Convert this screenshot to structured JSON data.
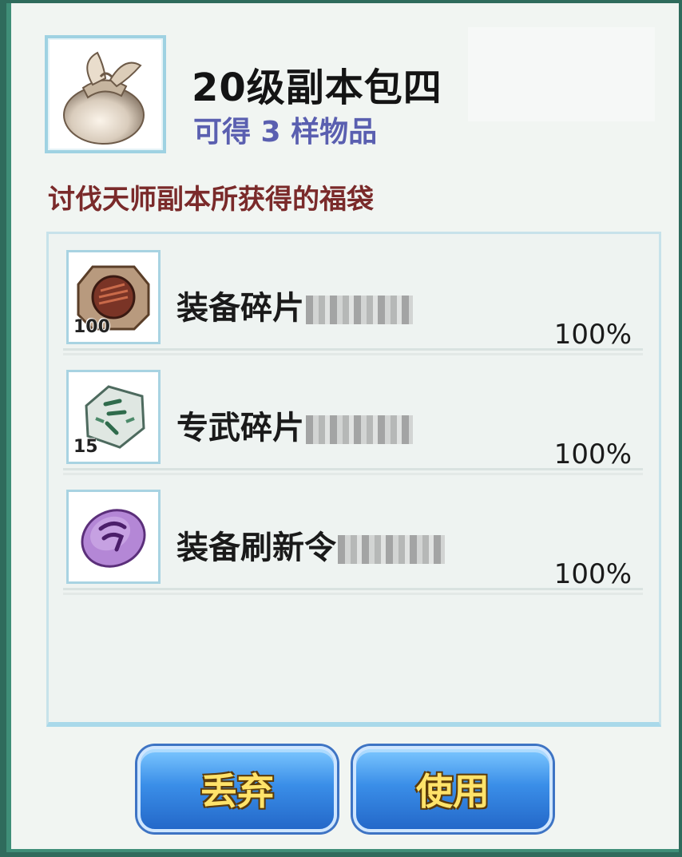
{
  "header": {
    "title": "20级副本包四",
    "subtitle": "可得 3 样物品",
    "icon": "cloth-bundle-icon"
  },
  "description": "讨伐天师副本所获得的福袋",
  "items": [
    {
      "name": "装备碎片",
      "count": "100",
      "chance": "100%",
      "icon": "equipment-shard-icon"
    },
    {
      "name": "专武碎片",
      "count": "15",
      "chance": "100%",
      "icon": "exclusive-weapon-shard-icon"
    },
    {
      "name": "装备刷新令",
      "count": "",
      "chance": "100%",
      "icon": "refresh-token-icon"
    }
  ],
  "buttons": {
    "discard": "丢弃",
    "use": "使用"
  },
  "colors": {
    "title": "#141414",
    "subtitle": "#5a5fb0",
    "description": "#7a2a2a",
    "button_text": "#ffe36a",
    "button_fill": "#3a8ee8"
  }
}
